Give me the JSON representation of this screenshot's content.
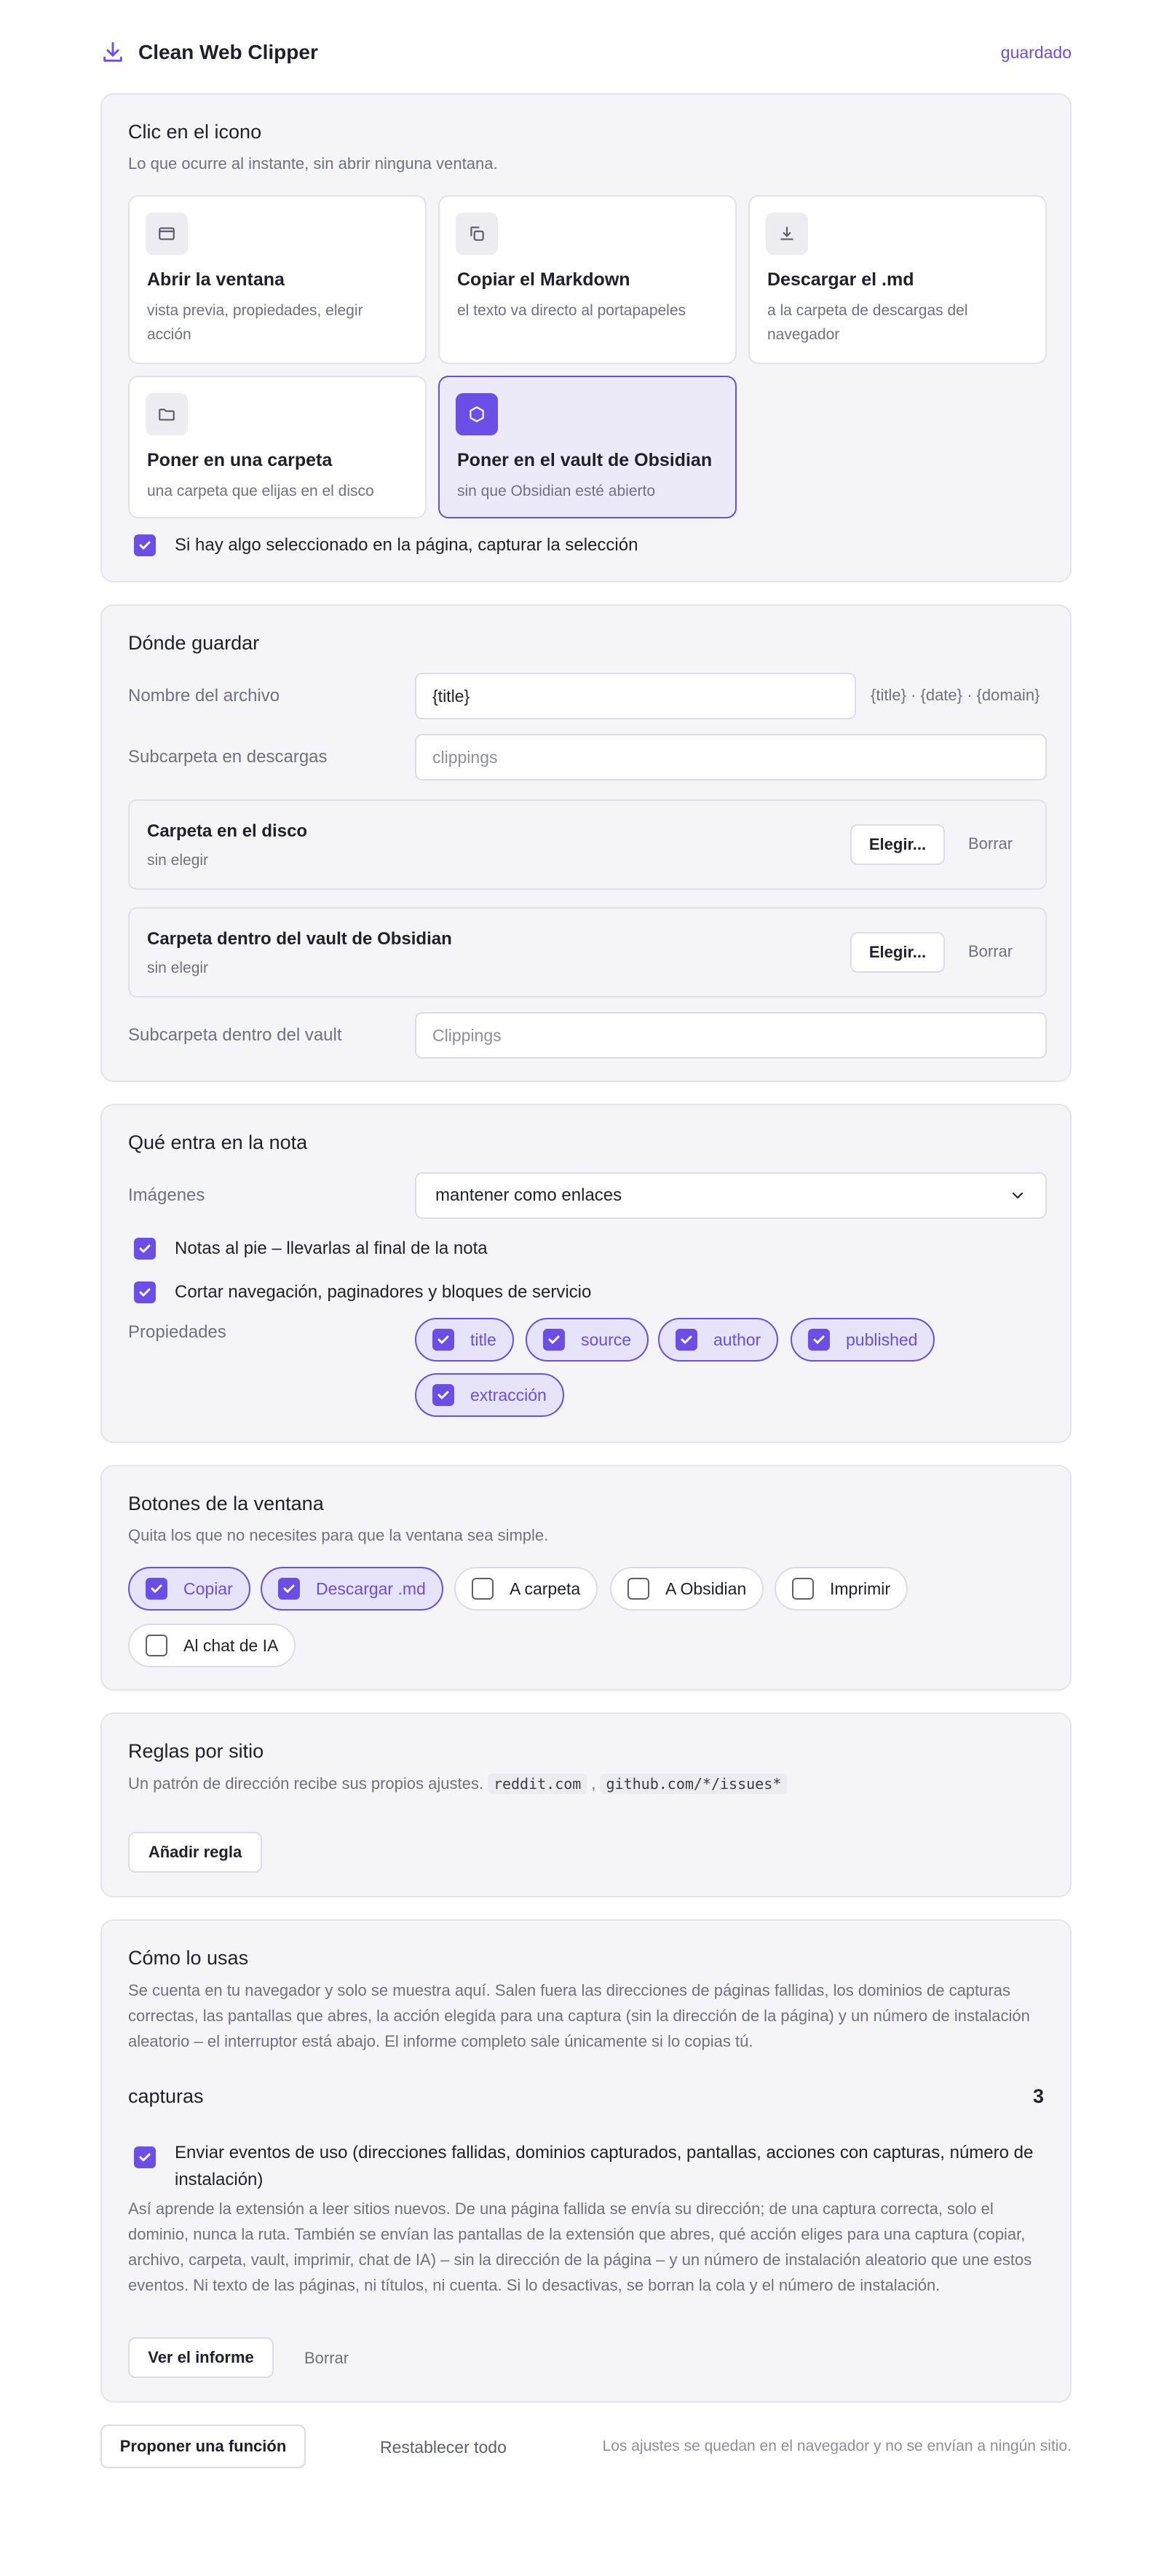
{
  "header": {
    "title": "Clean Web Clipper",
    "status": "guardado"
  },
  "click_section": {
    "title": "Clic en el icono",
    "subtitle": "Lo que ocurre al instante, sin abrir ninguna ventana.",
    "actions": [
      {
        "icon": "window-icon",
        "title": "Abrir la ventana",
        "desc": "vista previa, propiedades, elegir acción",
        "selected": false
      },
      {
        "icon": "copy-icon",
        "title": "Copiar el Markdown",
        "desc": "el texto va directo al portapapeles",
        "selected": false
      },
      {
        "icon": "download-icon",
        "title": "Descargar el .md",
        "desc": "a la carpeta de descargas del navegador",
        "selected": false
      },
      {
        "icon": "folder-icon",
        "title": "Poner en una carpeta",
        "desc": "una carpeta que elijas en el disco",
        "selected": false
      },
      {
        "icon": "obsidian-icon",
        "title": "Poner en el vault de Obsidian",
        "desc": "sin que Obsidian esté abierto",
        "selected": true
      }
    ],
    "capture_selection_label": "Si hay algo seleccionado en la página, capturar la selección",
    "capture_selection_checked": true
  },
  "save_section": {
    "title": "Dónde guardar",
    "filename_label": "Nombre del archivo",
    "filename_value": "{title}",
    "filename_hint": "{title} · {date} · {domain}",
    "downloads_subfolder_label": "Subcarpeta en descargas",
    "downloads_subfolder_placeholder": "clippings",
    "disk_folder": {
      "title": "Carpeta en el disco",
      "value": "sin elegir",
      "choose": "Elegir...",
      "clear": "Borrar"
    },
    "vault_folder": {
      "title": "Carpeta dentro del vault de Obsidian",
      "value": "sin elegir",
      "choose": "Elegir...",
      "clear": "Borrar"
    },
    "vault_subfolder_label": "Subcarpeta dentro del vault",
    "vault_subfolder_placeholder": "Clippings"
  },
  "content_section": {
    "title": "Qué entra en la nota",
    "images_label": "Imágenes",
    "images_value": "mantener como enlaces",
    "footnotes_label": "Notas al pie – llevarlas al final de la nota",
    "footnotes_checked": true,
    "strip_nav_label": "Cortar navegación, paginadores y bloques de servicio",
    "strip_nav_checked": true,
    "properties_label": "Propiedades",
    "properties": [
      {
        "label": "title",
        "checked": true
      },
      {
        "label": "source",
        "checked": true
      },
      {
        "label": "author",
        "checked": true
      },
      {
        "label": "published",
        "checked": true
      },
      {
        "label": "extracción",
        "checked": true
      }
    ]
  },
  "buttons_section": {
    "title": "Botones de la ventana",
    "subtitle": "Quita los que no necesites para que la ventana sea simple.",
    "buttons": [
      {
        "label": "Copiar",
        "checked": true
      },
      {
        "label": "Descargar .md",
        "checked": true
      },
      {
        "label": "A carpeta",
        "checked": false
      },
      {
        "label": "A Obsidian",
        "checked": false
      },
      {
        "label": "Imprimir",
        "checked": false
      },
      {
        "label": "Al chat de IA",
        "checked": false
      }
    ]
  },
  "rules_section": {
    "title": "Reglas por sitio",
    "subtitle": "Un patrón de dirección recibe sus propios ajustes.",
    "example_1": "reddit.com",
    "separator": ",",
    "example_2": "github.com/*/issues*",
    "add_button": "Añadir regla"
  },
  "usage_section": {
    "title": "Cómo lo usas",
    "description": "Se cuenta en tu navegador y solo se muestra aquí. Salen fuera las direcciones de páginas fallidas, los dominios de capturas correctas, las pantallas que abres, la acción elegida para una captura (sin la dirección de la página) y un número de instalación aleatorio – el interruptor está abajo. El informe completo sale únicamente si lo copias tú.",
    "captures_label": "capturas",
    "captures_count": "3",
    "send_events_label": "Enviar eventos de uso (direcciones fallidas, dominios capturados, pantallas, acciones con capturas, número de instalación)",
    "send_events_checked": true,
    "send_events_desc": "Así aprende la extensión a leer sitios nuevos. De una página fallida se envía su dirección; de una captura correcta, solo el dominio, nunca la ruta. También se envían las pantallas de la extensión que abres, qué acción eliges para una captura (copiar, archivo, carpeta, vault, imprimir, chat de IA) – sin la dirección de la página – y un número de instalación aleatorio que une estos eventos. Ni texto de las páginas, ni títulos, ni cuenta. Si lo desactivas, se borran la cola y el número de instalación.",
    "view_report": "Ver el informe",
    "clear": "Borrar"
  },
  "footer": {
    "suggest_button": "Proponer una función",
    "reset_button": "Restablecer todo",
    "note": "Los ajustes se quedan en el navegador y no se envían a ningún sitio."
  },
  "colors": {
    "accent": "#6a4ee6",
    "card_bg": "#f5f5f7",
    "muted_text": "#6f7080"
  }
}
